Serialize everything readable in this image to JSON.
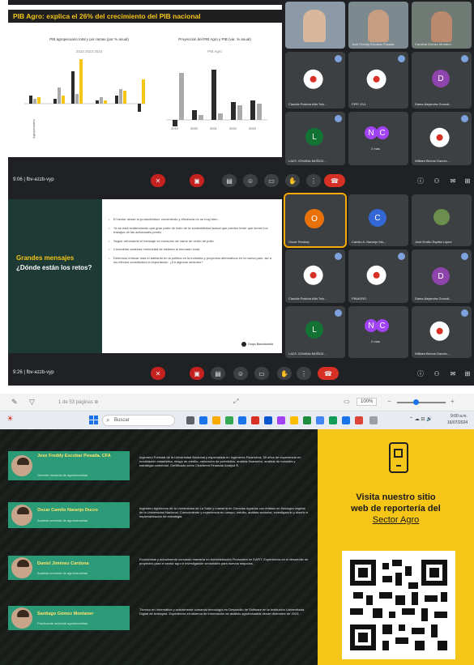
{
  "meeting1": {
    "slide_title": "PIB Agro: explica el 26% del crecimiento del PIB nacional",
    "chart_left_title": "PIB agropecuario total y por ramas (por % anual)",
    "chart_right_title": "Proyección del PIB Agro y PIB (var. % anual)",
    "legend_left": "2022  2023  2024",
    "legend_right": "PIB  Agro",
    "bar_labels": [
      "0,6",
      "1,2",
      "3,6",
      "2,9",
      "8,6",
      "2,7",
      "1,6",
      "-0,7"
    ],
    "participants": [
      {
        "name": "",
        "type": "video"
      },
      {
        "name": "José Freddy Escobar Posada",
        "type": "video"
      },
      {
        "name": "Carolina Gómez Montero",
        "type": "video"
      },
      {
        "name": "Claudia Patricia Alfa Tolo...",
        "type": "logo"
      },
      {
        "name": "FIPE GVL",
        "type": "logo"
      },
      {
        "name": "Diana Alejandra Gonzál...",
        "type": "letter",
        "letter": "D"
      },
      {
        "name": "LADY JOHANA MUÑOZ...",
        "type": "letter",
        "letter": "L"
      },
      {
        "name": "2 más",
        "type": "multi",
        "letters": [
          "N",
          "C"
        ]
      },
      {
        "name": "William Bernal Garcés...",
        "type": "logo"
      }
    ],
    "meet_code": "9:06 | fbv-ezzb-vyp"
  },
  "meeting2": {
    "slide_title_1": "Grandes mensajes",
    "slide_title_2": "¿Dónde están los retos?",
    "bullets": [
      "El sector desde la productividad, crecimiento y eficiencia es un muy bien.",
      "Ya se está evidenciando que gran parte de éxito de la sostenibilidad actual que preciso tener que tienen los trabajos de las actividades predic.",
      "Seguir reforzando el mensaje en consumo de carne de cerdo de pollo.",
      "Consolidar cadenas Inmunidad de sistema al mercado local.",
      "Debemos enfocar más el adelanto en la política en la industria y proyectos alternativos en la nueva país, así a los efectos constituidos la exportación. ¿En algunos sectores?"
    ],
    "brand": "Grupo Bancolombia",
    "participants": [
      {
        "name": "Oscar Restrep",
        "type": "letter",
        "letter": "O"
      },
      {
        "name": "Camilo A. Naranjo Ma...",
        "type": "letter",
        "letter": "C"
      },
      {
        "name": "José Emilio Espitia López",
        "type": "photo"
      },
      {
        "name": "Claudia Patricia Alfa Tolo...",
        "type": "logo"
      },
      {
        "name": "FINAGRO",
        "type": "logo"
      },
      {
        "name": "Diana Alejandra Gonzál...",
        "type": "letter",
        "letter": "D"
      },
      {
        "name": "LADY JOHANA MUÑOZ...",
        "type": "letter",
        "letter": "L"
      },
      {
        "name": "2 más",
        "type": "multi",
        "letters": [
          "N",
          "C"
        ]
      },
      {
        "name": "William Bernal Garcés...",
        "type": "logo"
      }
    ],
    "meet_code": "9:26 | fbv-ezzb-vyp"
  },
  "pdf_toolbar": {
    "page_info": "1  de 53  páginas  ⊕",
    "zoom": "100%"
  },
  "taskbar": {
    "search_placeholder": "Buscar",
    "clock_time": "9:00 a.m.",
    "clock_date": "16/07/2024"
  },
  "team": [
    {
      "name": "Jose Freddy Escobar Posada, CFA",
      "role": "Gerente sectorial de agroindustrias",
      "desc": "Ingeniero Forestal de la Universidad Nacional y especialista en Ingeniería Financiera. 30 años de experiencia en modelación estadística, riesgo de crédito, valoración de portafolios, análisis financiero, análisis de industria y estrategia comercial. Certificado como Chartered Financial Analyst ®."
    },
    {
      "name": "Oscar Camilo Naranjo Ducro",
      "role": "Analista sectorial de agroindustrias",
      "desc": "Ingeniero Agrónomo de la Universidad de La Salle y maestría en Ciencias Agrarias con énfasis en fisiología vegetal de la Universidad Nacional. Conocimiento y experiencia en campo, crédito, análisis sectorial, investigación y diseño e implementación de estrategia."
    },
    {
      "name": "Daniel Jiménez Cardona",
      "role": "Analista sectorial de agroindustrias",
      "desc": "Economista y actualmente cursando maestría en Administración Financiera en EAFIT. Experiencia en el desarrollo de proyectos para el sector agro e investigación sectoriales para nuevos negocios."
    },
    {
      "name": "Santiago Gómez Montaner",
      "role": "Practicante sectorial agroindustrias",
      "desc": "Técnico en Informática y actualmente cursando tecnología en Desarrollo de Software en la Institución Universitaria Digital de Antioquia. Experiencia en sistema de información de análisis agroindustrial desde diciembre de 2023."
    }
  ],
  "promo": {
    "line1": "Visita nuestro sitio",
    "line2": "web de reportería del",
    "line3": "Sector Agro"
  },
  "colors": {
    "meet_bg": "#202124",
    "tile_bg": "#3c4043",
    "accent_green": "#2b9a77",
    "accent_yellow": "#f5c518",
    "end_call": "#d93025"
  }
}
